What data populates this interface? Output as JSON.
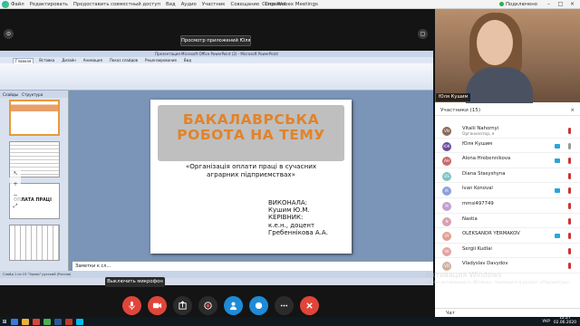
{
  "window": {
    "title": "Cisco Webex Meetings",
    "connected": "Подключено"
  },
  "menu": [
    "Файл",
    "Редактировать",
    "Предоставить совместный доступ",
    "Вид",
    "Аудио",
    "Участник",
    "Совещание",
    "Справка"
  ],
  "share": {
    "banner": "Просмотр приложений Юля..."
  },
  "ppt": {
    "title": "Презентация Microsoft Office PowerPoint (2) - Microsoft PowerPoint",
    "tabs": [
      "Главная",
      "Вставка",
      "Дизайн",
      "Анимация",
      "Показ слайдов",
      "Рецензирование",
      "Вид"
    ],
    "pane_tabs": [
      "Слайды",
      "Структура"
    ],
    "notes": "Заметки к сл...",
    "status": "Слайд 1 из 15    \"Эркер\"    русский (Россия)"
  },
  "slide": {
    "heading": "БАКАЛАВРСЬКА\nРОБОТА НА ТЕМУ",
    "subtitle": "«Організація оплати праці в сучасних\nаграрних підприємствах»",
    "author": "ВИКОНАЛА:\nКушим Ю.М.\nКЕРІВНИК:\nк.е.н., доцент\nГребеннікова А.А."
  },
  "thumb2_label": "ОПЛАТА ПРАЦІ",
  "tooltip": "Выключить микрофон",
  "video": {
    "name": "Юля Кушим"
  },
  "participants": {
    "header": "Участники (15)",
    "close": "×"
  },
  "people": [
    {
      "name": "Vitalii Nahornyi",
      "role": "Организатор, я",
      "initials": "VN",
      "color": "#8c6a5a"
    },
    {
      "name": "Юля Кушим",
      "role": "",
      "initials": "ЮК",
      "color": "#6a4a9c"
    },
    {
      "name": "Alona Hrebennikova",
      "role": "",
      "initials": "AH",
      "color": "#c46a6a"
    },
    {
      "name": "Diana Stasyshyna",
      "role": "",
      "initials": "DS",
      "color": "#7cc4c0"
    },
    {
      "name": "Ivan Konoval",
      "role": "",
      "initials": "IK",
      "color": "#8da1d6"
    },
    {
      "name": "mmsi497749",
      "role": "",
      "initials": "M",
      "color": "#c0a0d0"
    },
    {
      "name": "Nastia",
      "role": "",
      "initials": "N",
      "color": "#d8a0b0"
    },
    {
      "name": "OLEKSANDR YERMAKOV",
      "role": "",
      "initials": "OY",
      "color": "#e0a090"
    },
    {
      "name": "Sergii Kudlai",
      "role": "",
      "initials": "SK",
      "color": "#e2a3a3"
    },
    {
      "name": "Vladyslav Davydov",
      "role": "",
      "initials": "VD",
      "color": "#d0b0a0"
    }
  ],
  "chat": "Чат",
  "watermark": {
    "line1": "Активация Windows",
    "line2": "Чтобы активировать Windows, перейдите в раздел «Параметры»."
  },
  "taskbar": {
    "lang": "УКР",
    "time": "12:27",
    "date": "02.06.2020"
  },
  "colors": {
    "accent": "#1d8bd8",
    "danger": "#e0453a",
    "slide_title": "#e0832c"
  }
}
